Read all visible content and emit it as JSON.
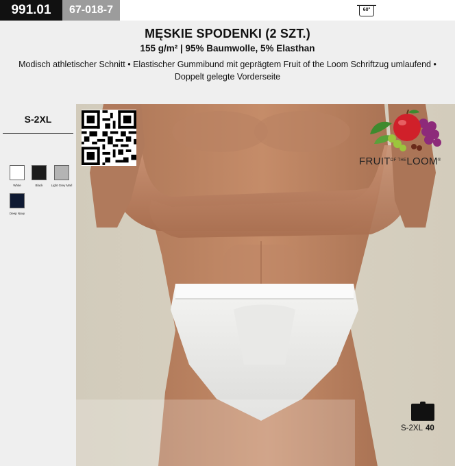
{
  "header": {
    "article_code": "991.01",
    "supplier_code": "67-018-7",
    "wash_icon": {
      "name": "wash-60-icon",
      "text": "60°"
    }
  },
  "product": {
    "title": "MĘSKIE SPODENKI (2 SZT.)",
    "specs": "155 g/m² | 95% Baumwolle, 5% Elasthan",
    "description": "Modisch athletischer Schnitt • Elastischer Gummibund mit geprägtem Fruit of the Loom Schriftzug umlaufend • Doppelt gelegte Vorderseite"
  },
  "sizes": {
    "range": "S-2XL"
  },
  "colors": [
    {
      "name": "White",
      "hex": "#ffffff"
    },
    {
      "name": "Black",
      "hex": "#1c1c1c"
    },
    {
      "name": "Light Grey Marl",
      "hex": "#b4b4b4"
    },
    {
      "name": "Deep Navy",
      "hex": "#0f1a33"
    }
  ],
  "brand": {
    "logo_pre": "FRUIT",
    "logo_of": "OF THE",
    "logo_post": "LOOM",
    "logo_mark": "®"
  },
  "pack": {
    "icon": "folded-shirt-icon",
    "sizes": "S-2XL",
    "quantity": "40"
  },
  "photo": {
    "icon": "product-photo",
    "qr": "qr-code"
  }
}
